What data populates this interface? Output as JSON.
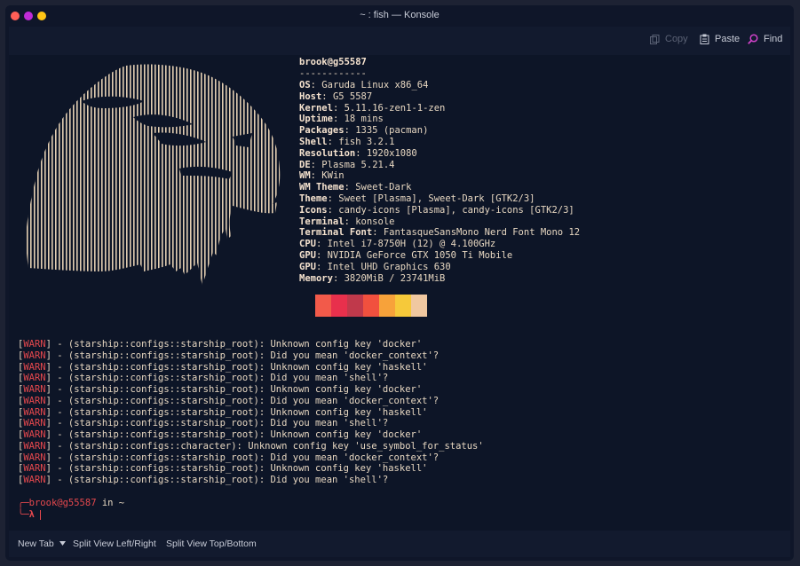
{
  "window": {
    "title": "~ : fish — Konsole",
    "traffic_lights": [
      "#ff5f57",
      "#c02bd6",
      "#ffc515"
    ]
  },
  "toolbar": {
    "copy_label": "Copy",
    "paste_label": "Paste",
    "find_label": "Find"
  },
  "neofetch": {
    "header": "brook@g55587",
    "separator": "------------",
    "info": [
      {
        "key": "OS",
        "value": ": Garuda Linux x86_64"
      },
      {
        "key": "Host",
        "value": ": G5 5587"
      },
      {
        "key": "Kernel",
        "value": ": 5.11.16-zen1-1-zen"
      },
      {
        "key": "Uptime",
        "value": ": 18 mins"
      },
      {
        "key": "Packages",
        "value": ": 1335 (pacman)"
      },
      {
        "key": "Shell",
        "value": ": fish 3.2.1"
      },
      {
        "key": "Resolution",
        "value": ": 1920x1080"
      },
      {
        "key": "DE",
        "value": ": Plasma 5.21.4"
      },
      {
        "key": "WM",
        "value": ": KWin"
      },
      {
        "key": "WM Theme",
        "value": ": Sweet-Dark"
      },
      {
        "key": "Theme",
        "value": ": Sweet [Plasma], Sweet-Dark [GTK2/3]"
      },
      {
        "key": "Icons",
        "value": ": candy-icons [Plasma], candy-icons [GTK2/3]"
      },
      {
        "key": "Terminal",
        "value": ": konsole"
      },
      {
        "key": "Terminal Font",
        "value": ": FantasqueSansMono Nerd Font Mono 12"
      },
      {
        "key": "CPU",
        "value": ": Intel i7-8750H (12) @ 4.100GHz"
      },
      {
        "key": "GPU",
        "value": ": NVIDIA GeForce GTX 1050 Ti Mobile"
      },
      {
        "key": "GPU",
        "value": ": Intel UHD Graphics 630"
      },
      {
        "key": "Memory",
        "value": ": 3820MiB / 23741MiB"
      }
    ],
    "palette": [
      "#f25a4a",
      "#e8304c",
      "#c0394b",
      "#f1503e",
      "#f7a23a",
      "#f6c93a",
      "#f0c8a0"
    ]
  },
  "warnings": [
    {
      "tag": "WARN",
      "text": "] - (starship::configs::starship_root): Unknown config key 'docker'"
    },
    {
      "tag": "WARN",
      "text": "] - (starship::configs::starship_root): Did you mean 'docker_context'?"
    },
    {
      "tag": "WARN",
      "text": "] - (starship::configs::starship_root): Unknown config key 'haskell'"
    },
    {
      "tag": "WARN",
      "text": "] - (starship::configs::starship_root): Did you mean 'shell'?"
    },
    {
      "tag": "WARN",
      "text": "] - (starship::configs::starship_root): Unknown config key 'docker'"
    },
    {
      "tag": "WARN",
      "text": "] - (starship::configs::starship_root): Did you mean 'docker_context'?"
    },
    {
      "tag": "WARN",
      "text": "] - (starship::configs::starship_root): Unknown config key 'haskell'"
    },
    {
      "tag": "WARN",
      "text": "] - (starship::configs::starship_root): Did you mean 'shell'?"
    },
    {
      "tag": "WARN",
      "text": "] - (starship::configs::starship_root): Unknown config key 'docker'"
    },
    {
      "tag": "WARN",
      "text": "] - (starship::configs::character): Unknown config key 'use_symbol_for_status'"
    },
    {
      "tag": "WARN",
      "text": "] - (starship::configs::starship_root): Did you mean 'docker_context'?"
    },
    {
      "tag": "WARN",
      "text": "] - (starship::configs::starship_root): Unknown config key 'haskell'"
    },
    {
      "tag": "WARN",
      "text": "] - (starship::configs::starship_root): Did you mean 'shell'?"
    }
  ],
  "prompt": {
    "corner_top": "╭─",
    "user_host": "brook@g55587",
    "location": " in ~",
    "corner_bottom": "╰─",
    "symbol": "λ"
  },
  "bottombar": {
    "new_tab_label": "New Tab",
    "split_lr_label": "Split View Left/Right",
    "split_tb_label": "Split View Top/Bottom"
  }
}
